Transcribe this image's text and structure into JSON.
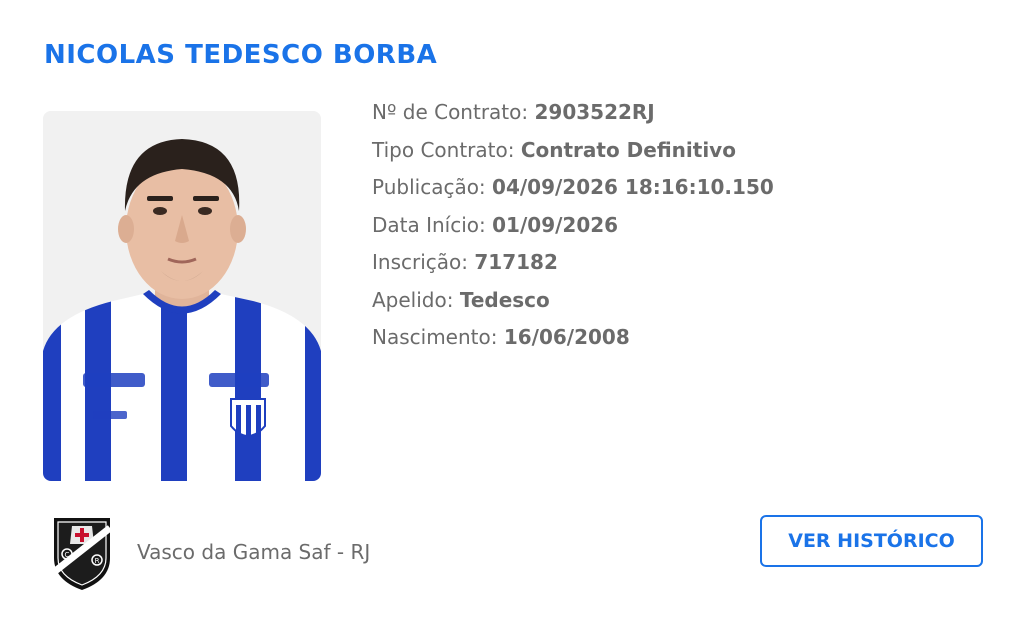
{
  "player": {
    "name": "NICOLAS TEDESCO BORBA"
  },
  "details": [
    {
      "label": "Nº de Contrato:",
      "value": "2903522RJ"
    },
    {
      "label": "Tipo Contrato:",
      "value": "Contrato Definitivo"
    },
    {
      "label": "Publicação:",
      "value": "04/09/2026 18:16:10.150"
    },
    {
      "label": "Data Início:",
      "value": "01/09/2026"
    },
    {
      "label": "Inscrição:",
      "value": "717182"
    },
    {
      "label": "Apelido:",
      "value": "Tedesco"
    },
    {
      "label": "Nascimento:",
      "value": "16/06/2008"
    }
  ],
  "club": {
    "name": "Vasco da Gama Saf - RJ",
    "logo_icon": "vasco-crest-icon"
  },
  "actions": {
    "history_label": "VER HISTÓRICO"
  },
  "colors": {
    "accent": "#1a73e8",
    "text": "#6b6b6b",
    "jersey_blue": "#1f3fbf"
  }
}
